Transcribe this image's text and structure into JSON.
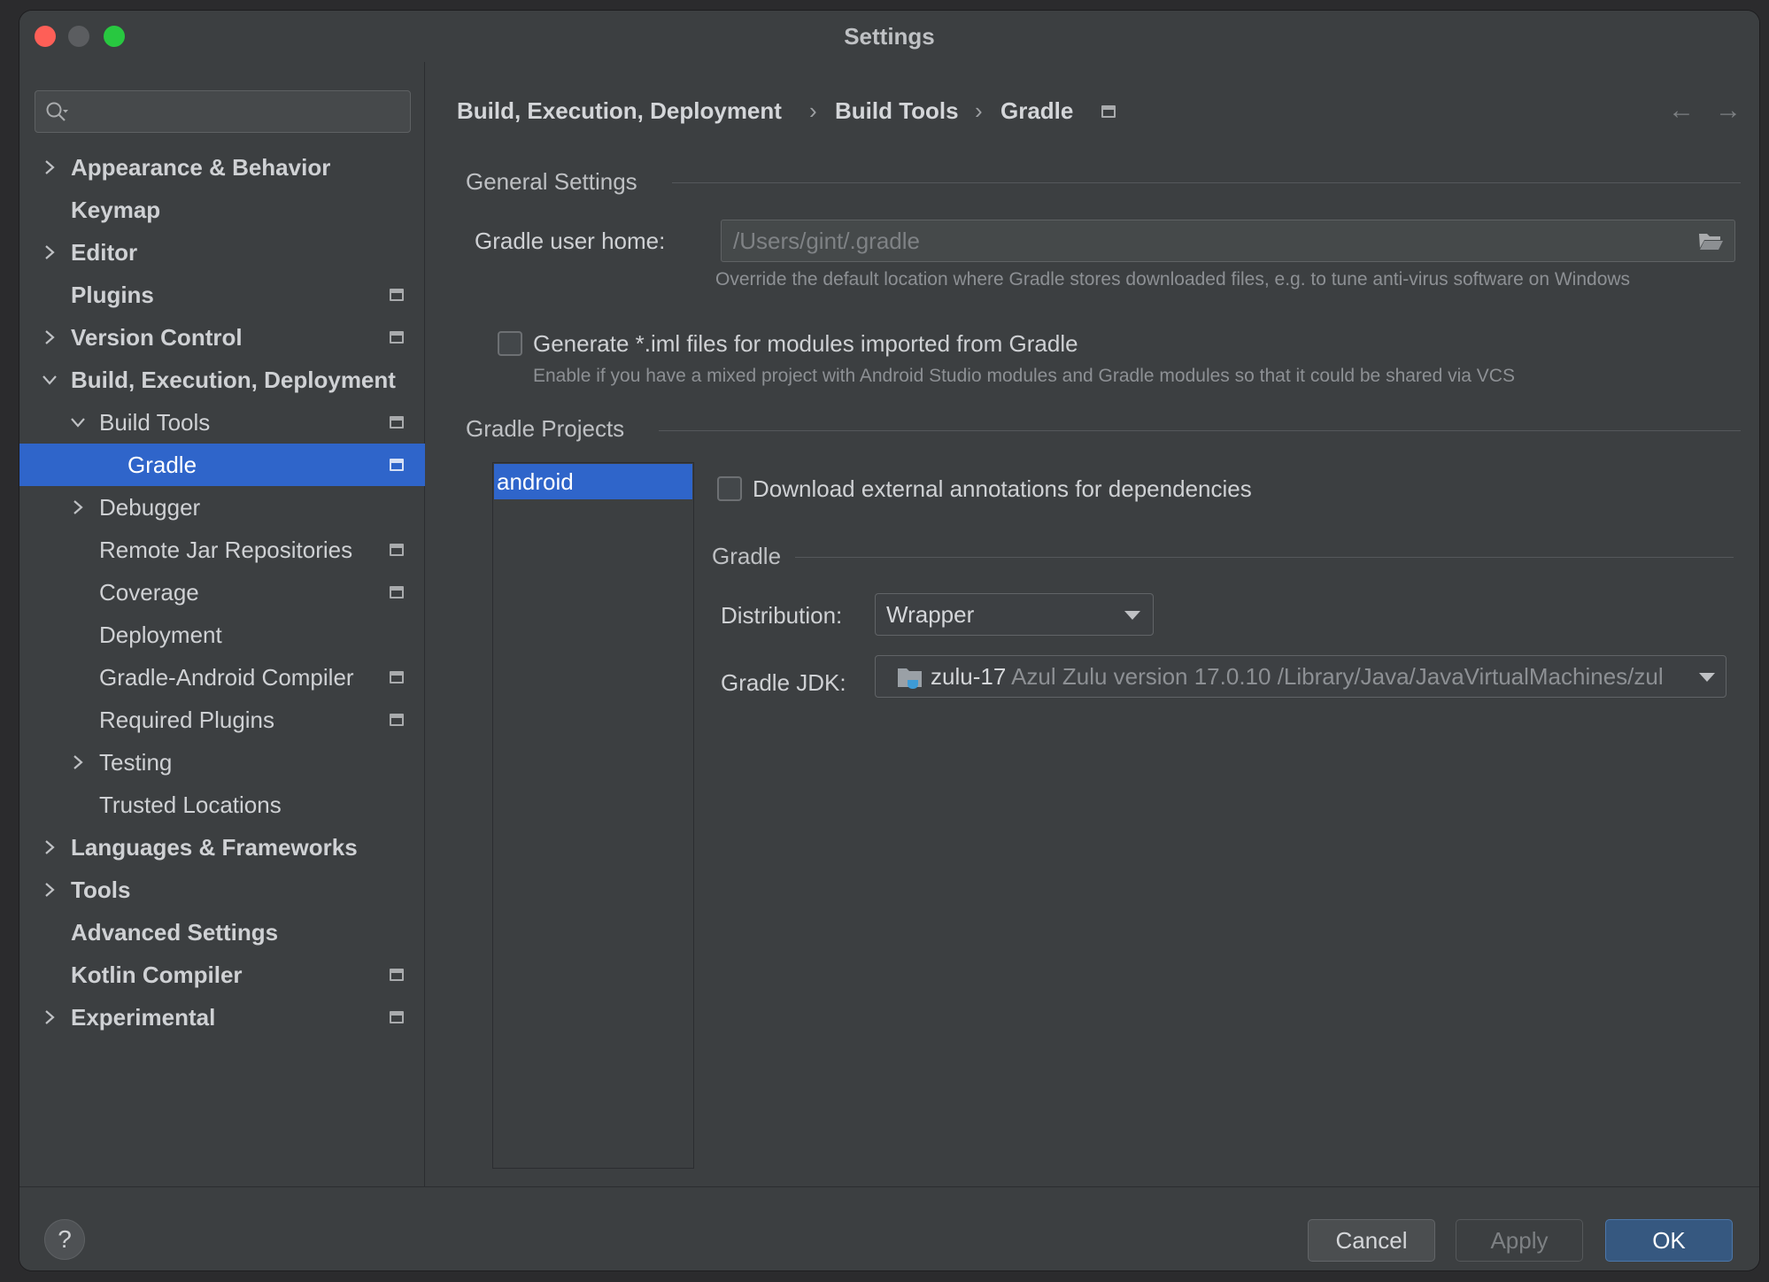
{
  "window": {
    "title": "Settings"
  },
  "search": {
    "placeholder": ""
  },
  "sidebar": {
    "items": [
      {
        "label": "Appearance & Behavior",
        "expandable": true
      },
      {
        "label": "Keymap"
      },
      {
        "label": "Editor",
        "expandable": true
      },
      {
        "label": "Plugins"
      },
      {
        "label": "Version Control",
        "expandable": true
      },
      {
        "label": "Build, Execution, Deployment",
        "expanded": true
      },
      {
        "label": "Build Tools",
        "expanded": true
      },
      {
        "label": "Gradle",
        "selected": true
      },
      {
        "label": "Debugger",
        "expandable": true
      },
      {
        "label": "Remote Jar Repositories"
      },
      {
        "label": "Coverage"
      },
      {
        "label": "Deployment"
      },
      {
        "label": "Gradle-Android Compiler"
      },
      {
        "label": "Required Plugins"
      },
      {
        "label": "Testing",
        "expandable": true
      },
      {
        "label": "Trusted Locations"
      },
      {
        "label": "Languages & Frameworks",
        "expandable": true
      },
      {
        "label": "Tools",
        "expandable": true
      },
      {
        "label": "Advanced Settings"
      },
      {
        "label": "Kotlin Compiler"
      },
      {
        "label": "Experimental",
        "expandable": true
      }
    ]
  },
  "breadcrumb": {
    "items": [
      "Build, Execution, Deployment",
      "Build Tools",
      "Gradle"
    ],
    "separator": "›"
  },
  "nav": {
    "back": "←",
    "forward": "→"
  },
  "general": {
    "title": "General Settings",
    "user_home_label": "Gradle user home:",
    "user_home_placeholder": "/Users/gint/.gradle",
    "user_home_hint": "Override the default location where Gradle stores downloaded files, e.g. to tune anti-virus software on Windows",
    "iml_label": "Generate *.iml files for modules imported from Gradle",
    "iml_checked": false,
    "iml_hint": "Enable if you have a mixed project with Android Studio modules and Gradle modules so that it could be shared via VCS"
  },
  "projects": {
    "title": "Gradle Projects",
    "list": [
      "android"
    ],
    "download_annotations_label": "Download external annotations for dependencies",
    "download_annotations_checked": false,
    "gradle_section_title": "Gradle",
    "distribution_label": "Distribution:",
    "distribution_value": "Wrapper",
    "jdk_label": "Gradle JDK:",
    "jdk_name": "zulu-17",
    "jdk_detail": "Azul Zulu version 17.0.10 /Library/Java/JavaVirtualMachines/zul"
  },
  "footer": {
    "help": "?",
    "cancel": "Cancel",
    "apply": "Apply",
    "ok": "OK"
  },
  "colors": {
    "selection": "#2f65ca",
    "ok_button": "#365880",
    "background": "#3c3f41"
  }
}
